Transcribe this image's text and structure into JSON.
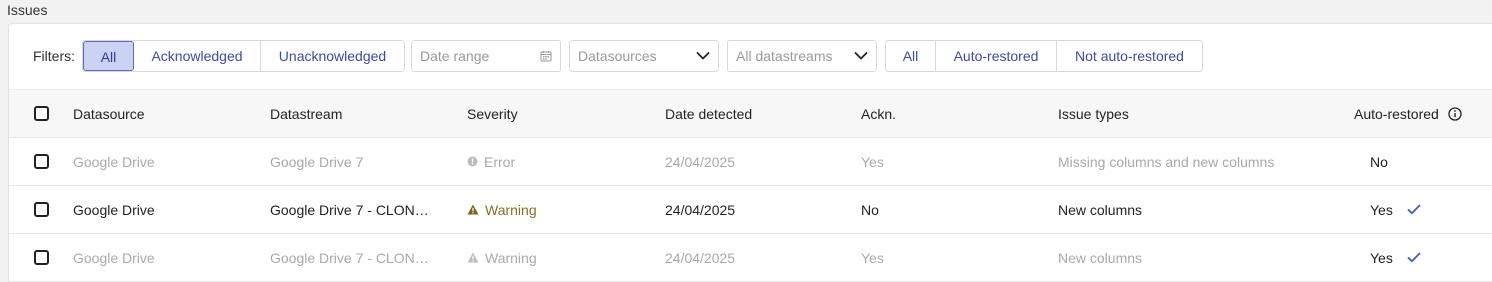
{
  "page": {
    "title": "Issues"
  },
  "filters": {
    "label": "Filters:",
    "ack_options": [
      "All",
      "Acknowledged",
      "Unacknowledged"
    ],
    "ack_selected": "All",
    "date_range_placeholder": "Date range",
    "datasources_placeholder": "Datasources",
    "datastreams_placeholder": "All datastreams",
    "auto_options": [
      "All",
      "Auto-restored",
      "Not auto-restored"
    ]
  },
  "table": {
    "columns": [
      "Datasource",
      "Datastream",
      "Severity",
      "Date detected",
      "Ackn.",
      "Issue types",
      "Auto-restored"
    ],
    "rows": [
      {
        "datasource": "Google Drive",
        "datastream": "Google Drive 7",
        "severity": "Error",
        "date": "24/04/2025",
        "ackn": "Yes",
        "issue_types": "Missing columns and new columns",
        "auto_restored": "No",
        "muted": true
      },
      {
        "datasource": "Google Drive",
        "datastream": "Google Drive 7 - CLON…",
        "severity": "Warning",
        "date": "24/04/2025",
        "ackn": "No",
        "issue_types": "New columns",
        "auto_restored": "Yes",
        "muted": false
      },
      {
        "datasource": "Google Drive",
        "datastream": "Google Drive 7 - CLON…",
        "severity": "Warning",
        "date": "24/04/2025",
        "ackn": "Yes",
        "issue_types": "New columns",
        "auto_restored": "Yes",
        "muted": true
      }
    ]
  },
  "colors": {
    "accent": "#3e4aa5",
    "active_bg": "#cbd3f5",
    "warning": "#8a6d1e",
    "check": "#4a57c4"
  },
  "icons": {
    "calendar": "calendar-icon",
    "chevron": "chevron-down-icon",
    "info": "info-icon",
    "error": "error-icon",
    "warning": "warning-icon",
    "check": "check-icon"
  }
}
